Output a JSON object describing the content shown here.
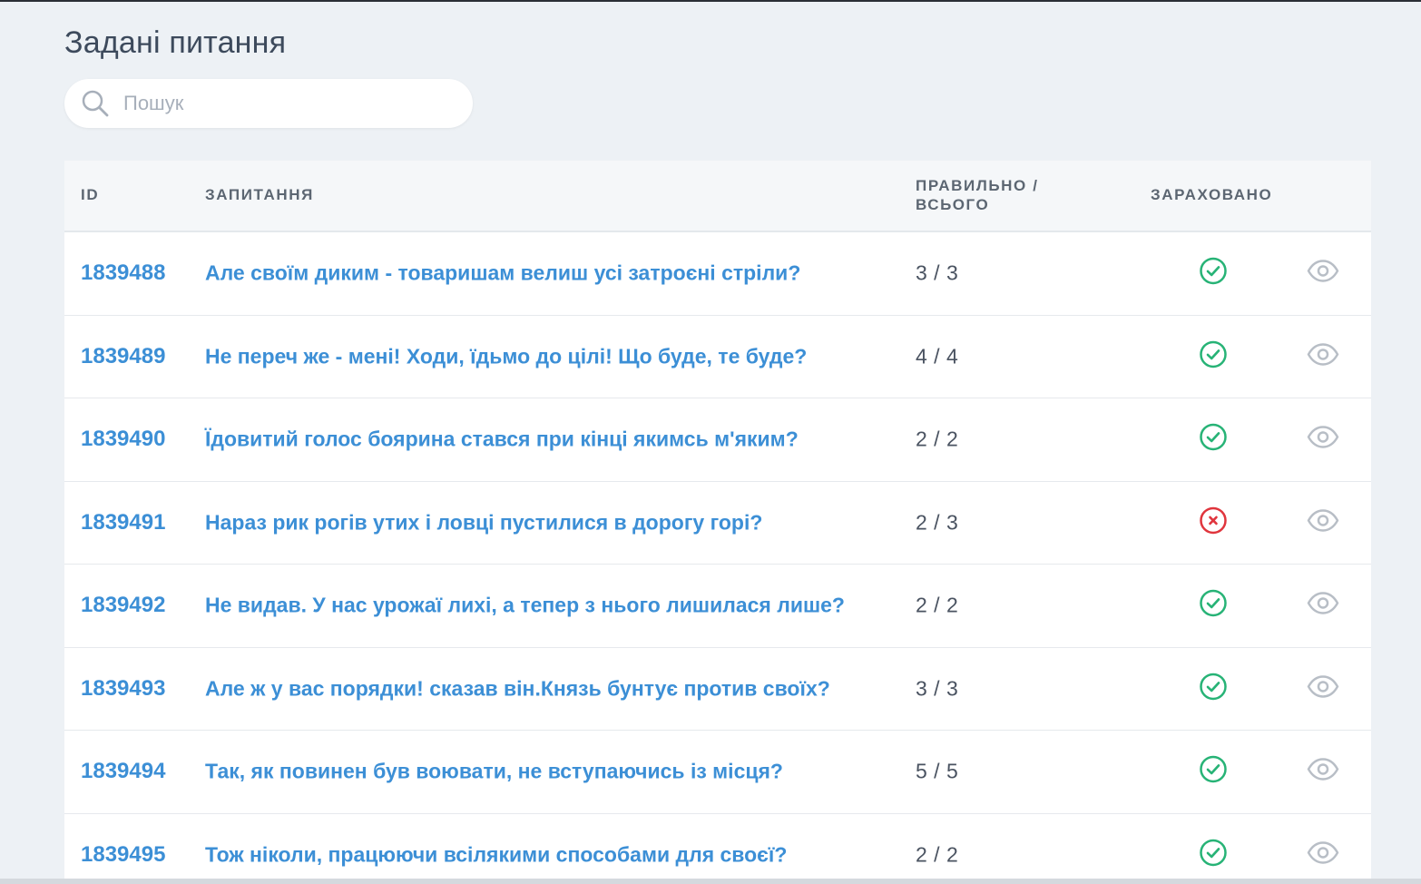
{
  "page": {
    "title": "Задані питання"
  },
  "search": {
    "placeholder": "Пошук",
    "icon": "search-icon"
  },
  "table": {
    "headers": {
      "id": "ID",
      "question": "ЗАПИТАННЯ",
      "score_line1": "ПРАВИЛЬНО /",
      "score_line2": "ВСЬОГО",
      "counted": "ЗАРАХОВАНО"
    },
    "rows": [
      {
        "id": "1839488",
        "question": "Але своїм диким - товаришам велиш усі затроєні стріли?",
        "score": "3 / 3",
        "counted": true
      },
      {
        "id": "1839489",
        "question": "Не переч же - мені! Ходи, їдьмо до цілі! Що буде, те буде?",
        "score": "4 / 4",
        "counted": true
      },
      {
        "id": "1839490",
        "question": "Їдовитий голос боярина стався при кінці якимсь м'яким?",
        "score": "2 / 2",
        "counted": true
      },
      {
        "id": "1839491",
        "question": "Нараз рик рогів утих і ловці пустилися в дорогу горі?",
        "score": "2 / 3",
        "counted": false
      },
      {
        "id": "1839492",
        "question": "Не видав. У нас урожаї лихі, а тепер з нього лишилася лише?",
        "score": "2 / 2",
        "counted": true
      },
      {
        "id": "1839493",
        "question": "Але ж у вас порядки! сказав він.Князь бунтує против своїх?",
        "score": "3 / 3",
        "counted": true
      },
      {
        "id": "1839494",
        "question": "Так, як повинен був воювати, не вступаючись із місця?",
        "score": "5 / 5",
        "counted": true
      },
      {
        "id": "1839495",
        "question": "Тож ніколи, працюючи всілякими способами для своєї?",
        "score": "2 / 2",
        "counted": true
      }
    ]
  },
  "colors": {
    "link": "#3c8fd6",
    "success": "#27b376",
    "error": "#e0353d",
    "view_icon": "#b8bec6"
  }
}
